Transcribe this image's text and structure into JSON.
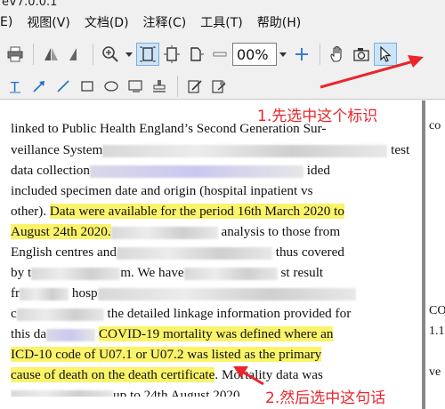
{
  "window": {
    "title_fragment": "eV7.0.0.1"
  },
  "menu": [
    "E)",
    "视图(V)",
    "文档(D)",
    "注释(C)",
    "工具(T)",
    "帮助(H)"
  ],
  "toolbar": {
    "zoom_value": "00%"
  },
  "document": {
    "lines": [
      {
        "text": "linked to Public Health England’s Second Generation Sur-"
      },
      {
        "pre": "veillance System",
        "post": " test"
      },
      {
        "pre": "data collection",
        "post": " ided"
      },
      {
        "text": "included specimen date and origin (hospital inpatient vs"
      },
      {
        "pre": "other). ",
        "hl": "Data were available for the period 16th March 2020 to"
      },
      {
        "hl": "August 24th 2020.",
        "post": " analysis to those from"
      },
      {
        "pre": "English centres and",
        "post": " thus covered"
      },
      {
        "pre": "by t",
        "post": "m. We have",
        "post2": " st result"
      },
      {
        "pre": "fr",
        "post": " hosp"
      },
      {
        "pre": "c",
        "post": " the detailed linkage information provided for"
      },
      {
        "pre": "this da",
        "hl": "COVID-19 mortality was defined where an"
      },
      {
        "hl": "ICD-10 code of U07.1 or U07.2 was listed as the primary"
      },
      {
        "hl": "cause of death on the death certificate",
        "post": ". Mortality data was"
      },
      {
        "post": "up to 24th August 2020"
      }
    ],
    "right_column": [
      "co",
      "CO",
      "1.1",
      "ve"
    ]
  },
  "annotations": {
    "step1": "1.先选中这个标识",
    "step2": "2.然后选中这句话"
  },
  "colors": {
    "highlight": "#fbf36a",
    "annotation": "#e8262b"
  }
}
